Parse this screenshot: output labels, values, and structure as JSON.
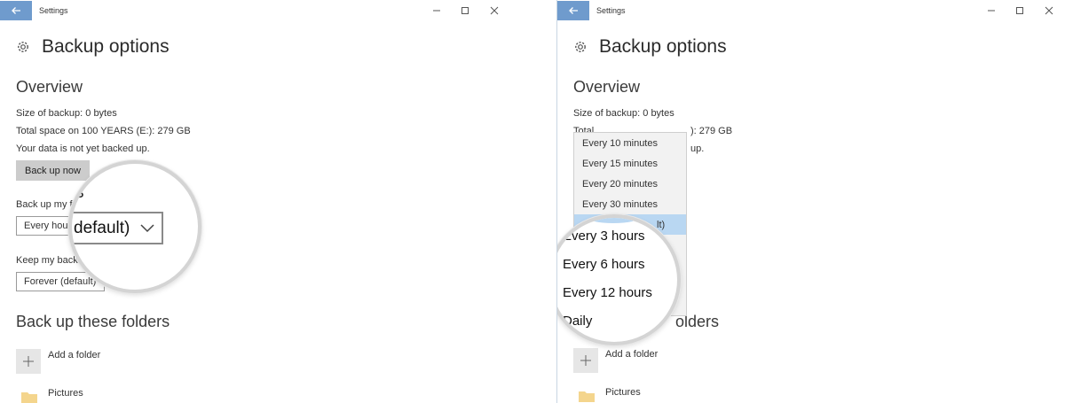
{
  "left": {
    "window_title": "Settings",
    "page_title": "Backup options",
    "overview_title": "Overview",
    "size_of_backup": "Size of backup: 0 bytes",
    "total_space": "Total space on 100 YEARS (E:): 279 GB",
    "status": "Your data is not yet backed up.",
    "backup_now_label": "Back up now",
    "frequency_label_partial": "Back up my fi",
    "frequency_value_partial": "Every hour",
    "keep_label_partial": "Keep my backu",
    "keep_value": "Forever (default)",
    "folders_title": "Back up these folders",
    "add_folder_label": "Add a folder",
    "folder_item": "Pictures",
    "magnifier": {
      "heading_fragment": "s",
      "select_value_fragment": "default)"
    }
  },
  "right": {
    "window_title": "Settings",
    "page_title": "Backup options",
    "overview_title": "Overview",
    "size_of_backup": "Size of backup: 0 bytes",
    "total_space_fragment_start": "Total",
    "total_space_fragment_end": "): 279 GB",
    "status_fragment": "up.",
    "folders_title_fragment": "olders",
    "add_folder_label": "Add a folder",
    "folder_item": "Pictures",
    "dropdown_options": [
      "Every 10 minutes",
      "Every 15 minutes",
      "Every 20 minutes",
      "Every 30 minutes",
      "",
      "",
      "",
      "",
      ""
    ],
    "selected_fragment": "lt)",
    "magnifier_options": [
      "Every 3 hours",
      "Every 6 hours",
      "Every 12 hours",
      "Daily"
    ]
  },
  "colors": {
    "accent": "#6f9bcd",
    "selected": "#b9d7f2",
    "button_bg": "#cccccc"
  }
}
